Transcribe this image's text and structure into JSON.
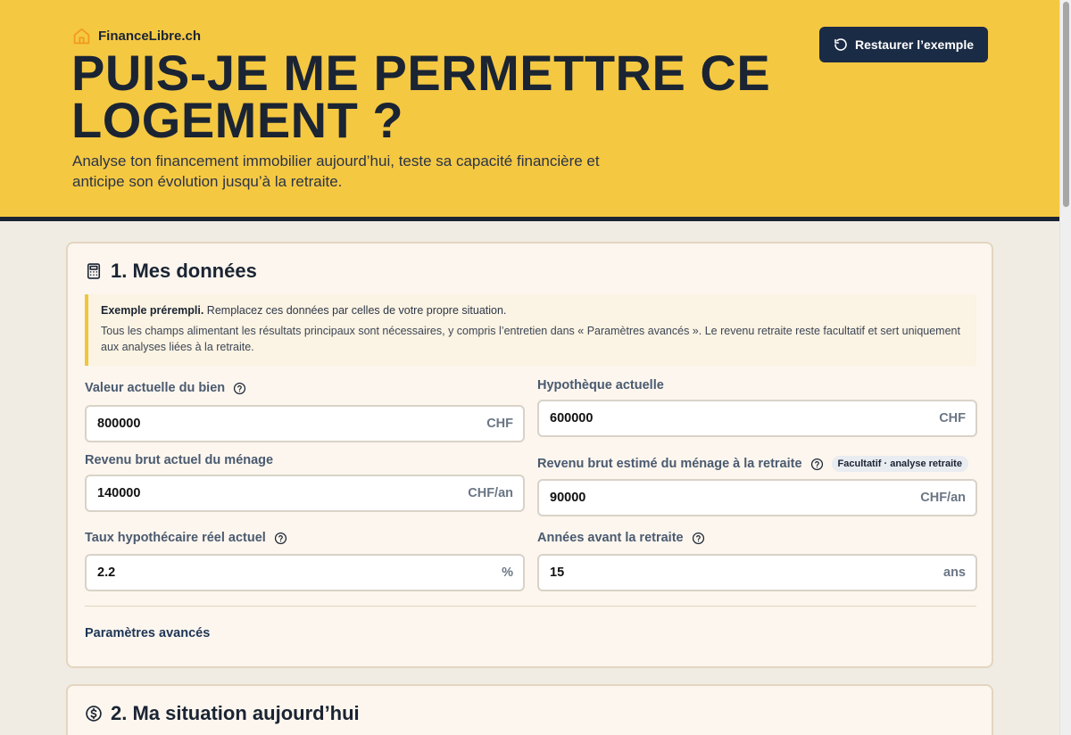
{
  "brand": {
    "name": "FinanceLibre.ch",
    "icon": "house-icon",
    "accent": "#f29a1d"
  },
  "header": {
    "title": "PUIS-JE ME PERMETTRE CE LOGEMENT ?",
    "subtitle": "Analyse ton financement immobilier aujourd’hui, teste sa capacité financière et anticipe son évolution jusqu’à la retraite.",
    "background": "#f5c842"
  },
  "restore_button": {
    "label": "Restaurer l’exemple",
    "icon": "rotate-ccw-icon"
  },
  "section1": {
    "title": "1. Mes données",
    "icon": "calculator-icon",
    "notice": {
      "bold": "Exemple prérempli.",
      "text": " Remplacez ces données par celles de votre propre situation.",
      "detail": "Tous les champs alimentant les résultats principaux sont nécessaires, y compris l’entretien dans « Paramètres avancés ». Le revenu retraite reste facultatif et sert uniquement aux analyses liées à la retraite."
    },
    "fields": {
      "property_value": {
        "label": "Valeur actuelle du bien",
        "value": "800000",
        "unit": "CHF"
      },
      "mortgage": {
        "label": "Hypothèque actuelle",
        "value": "600000",
        "unit": "CHF"
      },
      "income": {
        "label": "Revenu brut actuel du ménage",
        "value": "140000",
        "unit": "CHF/an"
      },
      "retirement_income": {
        "label": "Revenu brut estimé du ménage à la retraite",
        "badge": "Facultatif · analyse retraite",
        "value": "90000",
        "unit": "CHF/an"
      },
      "rate": {
        "label": "Taux hypothécaire réel actuel",
        "value": "2.2",
        "unit": "%"
      },
      "years": {
        "label": "Années avant la retraite",
        "value": "15",
        "unit": "ans"
      }
    },
    "advanced_label": "Paramètres avancés"
  },
  "section2": {
    "title": "2. Ma situation aujourd’hui",
    "icon": "dollar-circle-icon"
  }
}
